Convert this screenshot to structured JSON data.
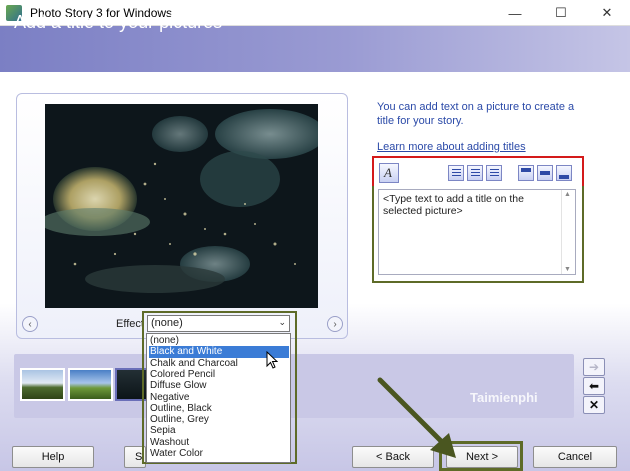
{
  "window": {
    "title": "Photo Story 3 for Windows",
    "controls": {
      "minimize": "—",
      "maximize": "☐",
      "close": "✕"
    }
  },
  "header": {
    "title": "Add a title to your pictures"
  },
  "instructions": {
    "text": "You can add text on a picture to create a title for your story.",
    "link": "Learn more about adding titles"
  },
  "text_editor": {
    "placeholder": "<Type text to add a title on the selected picture>",
    "tools": [
      "font-icon",
      "align-left-icon",
      "align-center-icon",
      "align-right-icon",
      "position-top-icon",
      "position-middle-icon",
      "position-bottom-icon"
    ]
  },
  "effect": {
    "label": "Effect",
    "selected": "(none)",
    "highlighted": "Black and White",
    "options": [
      "(none)",
      "Black and White",
      "Chalk and Charcoal",
      "Colored Pencil",
      "Diffuse Glow",
      "Negative",
      "Outline, Black",
      "Outline, Grey",
      "Sepia",
      "Washout",
      "Water Color"
    ]
  },
  "filmstrip": {
    "side_buttons": {
      "move_right": "➔",
      "move_left": "⬅",
      "remove": "✕"
    }
  },
  "watermark": "Taimienphi",
  "buttons": {
    "help": "Help",
    "save": "S",
    "back": "< Back",
    "next": "Next >",
    "cancel": "Cancel"
  },
  "colors": {
    "header": "#8a8dcb",
    "red_highlight": "#d41a1a",
    "olive_highlight": "#5e6b28",
    "link": "#2b4aa8",
    "selection": "#3b7cd6"
  }
}
